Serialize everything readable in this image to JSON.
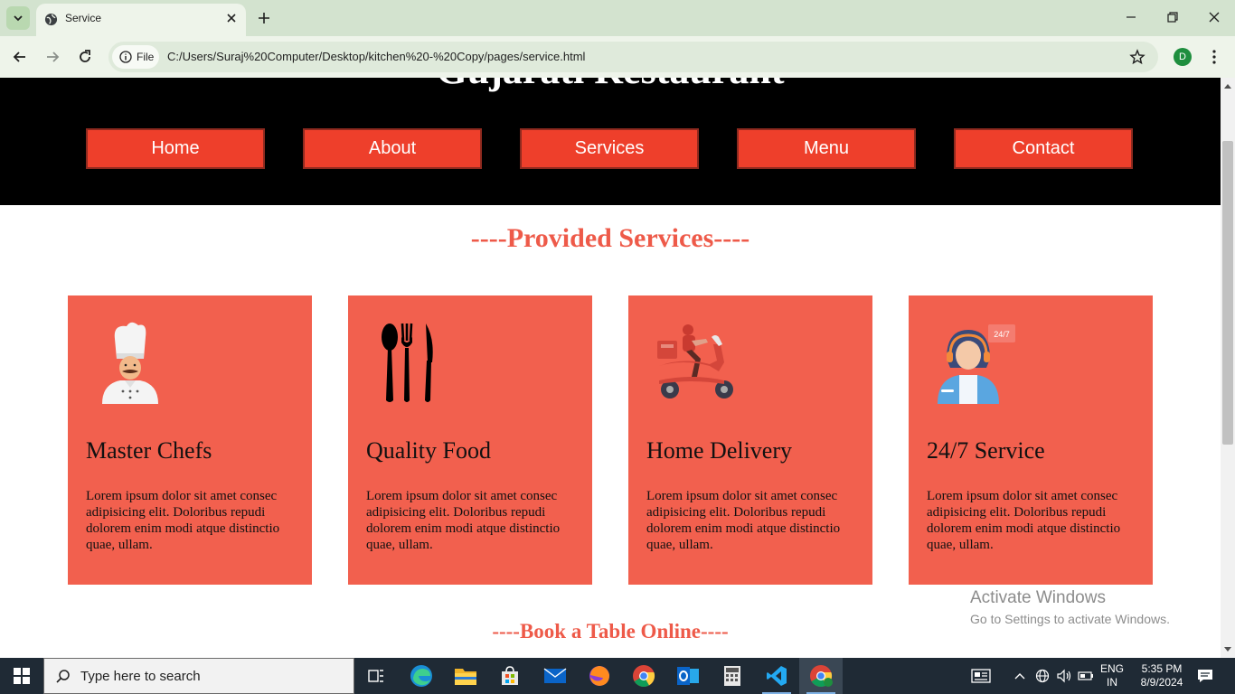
{
  "browser": {
    "tab_title": "Service",
    "site_chip_label": "File",
    "url": "C:/Users/Suraj%20Computer/Desktop/kitchen%20-%20Copy/pages/service.html",
    "profile_initial": "D"
  },
  "page": {
    "site_title": "Gujarati Restaurant",
    "nav": [
      "Home",
      "About",
      "Services",
      "Menu",
      "Contact"
    ],
    "services_heading": "----Provided Services----",
    "cards": [
      {
        "title": "Master Chefs",
        "text": "Lorem ipsum dolor sit amet consec adipisicing elit. Doloribus repudi dolorem enim modi atque distinctio quae, ullam.",
        "icon": "chef-icon"
      },
      {
        "title": "Quality Food",
        "text": "Lorem ipsum dolor sit amet consec adipisicing elit. Doloribus repudi dolorem enim modi atque distinctio quae, ullam.",
        "icon": "cutlery-icon"
      },
      {
        "title": "Home Delivery",
        "text": "Lorem ipsum dolor sit amet consec adipisicing elit. Doloribus repudi dolorem enim modi atque distinctio quae, ullam.",
        "icon": "delivery-scooter-icon"
      },
      {
        "title": "24/7 Service",
        "text": "Lorem ipsum dolor sit amet consec adipisicing elit. Doloribus repudi dolorem enim modi atque distinctio quae, ullam.",
        "icon": "support-agent-icon",
        "badge": "24/7"
      }
    ],
    "book_heading": "----Book a Table Online----"
  },
  "watermark": {
    "title": "Activate Windows",
    "subtitle": "Go to Settings to activate Windows."
  },
  "taskbar": {
    "search_placeholder": "Type here to search",
    "language_line1": "ENG",
    "language_line2": "IN",
    "time": "5:35 PM",
    "date": "8/9/2024"
  },
  "colors": {
    "accent_red": "#ee3f2b",
    "card_red": "#f2604e",
    "heading_red": "#ee5a49",
    "chrome_green": "#d3e3cf"
  }
}
